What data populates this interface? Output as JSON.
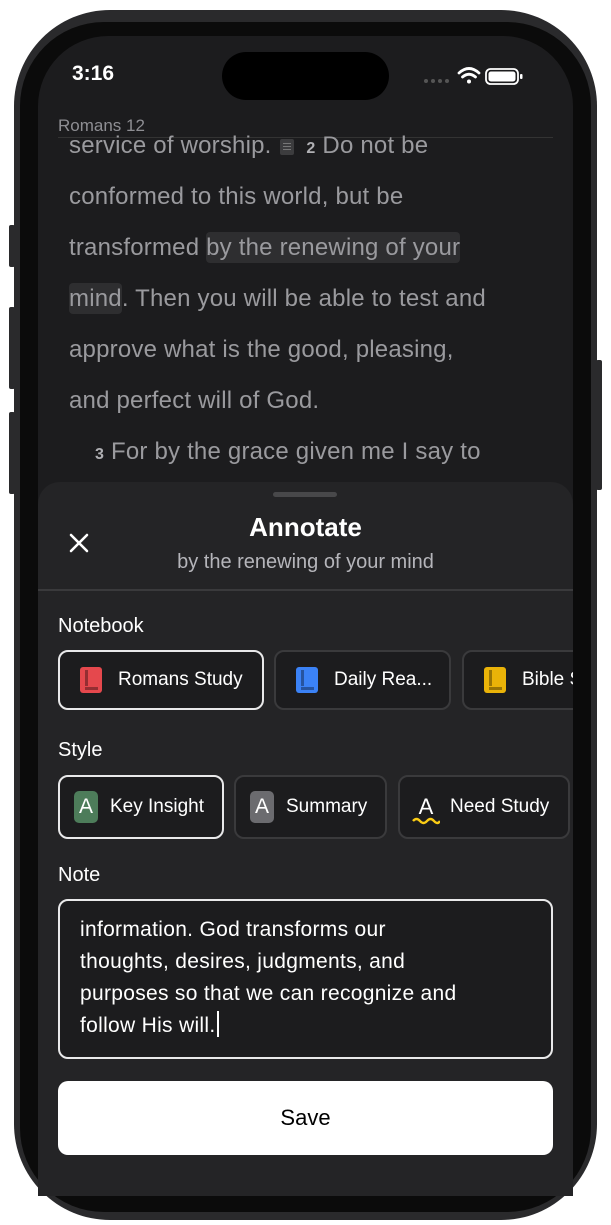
{
  "status": {
    "time": "3:16"
  },
  "reader": {
    "book_header": "Romans 12",
    "line1_a": "service of worship.",
    "line1_vnum": "2",
    "line1_b": "Do not be",
    "line2": "conformed to this world, but be",
    "line3_a": "transformed ",
    "line3_hl": "by the renewing of your",
    "line4_hl": "mind",
    "line4_b": ". Then you will be able to test and",
    "line5": "approve what is the good, pleasing,",
    "line6": "and perfect will of God.",
    "line7_vnum": "3",
    "line7": "For by the grace given me I say to"
  },
  "sheet": {
    "title": "Annotate",
    "subtitle": "by the renewing of your mind",
    "notebook_label": "Notebook",
    "notebooks": [
      {
        "label": "Romans Study",
        "color": "#e5484d",
        "selected": true
      },
      {
        "label": "Daily Rea...",
        "color": "#3b82f6",
        "selected": false
      },
      {
        "label": "Bible S",
        "color": "#eab308",
        "selected": false
      }
    ],
    "style_label": "Style",
    "styles": [
      {
        "label": "Key Insight",
        "glyph": "A",
        "color": "#4d7c5a",
        "selected": true
      },
      {
        "label": "Summary",
        "glyph": "A",
        "color": "#6b6b6f",
        "selected": false
      },
      {
        "label": "Need Study",
        "glyph": "A",
        "color": "#facc15",
        "selected": false
      }
    ],
    "note_label": "Note",
    "note_lines": [
      "information. God transforms our",
      "thoughts, desires, judgments, and",
      "purposes so that we can recognize and",
      "follow His will."
    ],
    "save_label": "Save"
  },
  "icons": {
    "close": "close-icon",
    "wifi": "wifi-icon",
    "battery": "battery-icon",
    "signal": "signal-icon",
    "notebook": "book-icon",
    "note_marker": "note-icon"
  }
}
